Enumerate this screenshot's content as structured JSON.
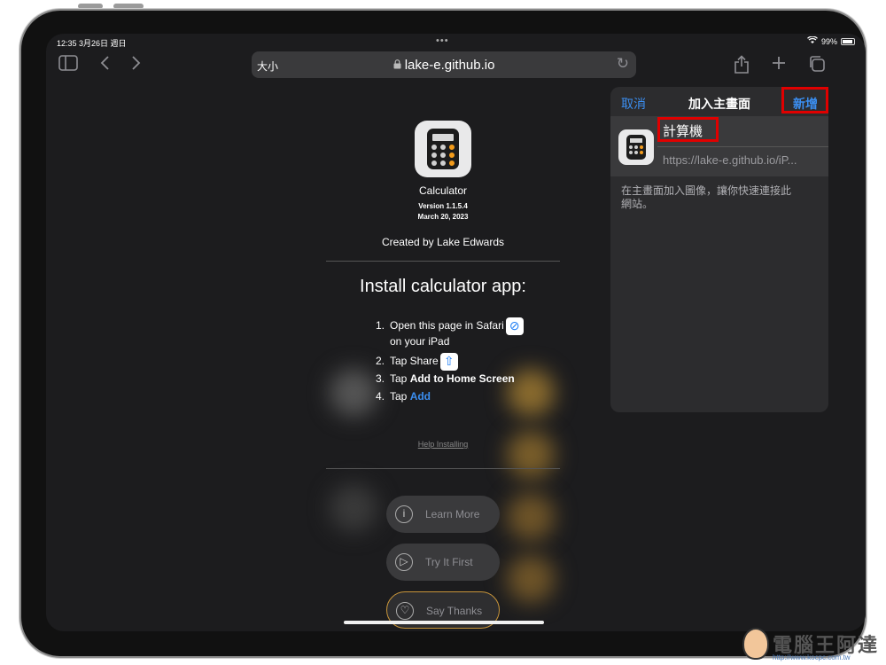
{
  "status": {
    "time_date": "12:35  3月26日 週日",
    "wifi_icon": "wifi-icon",
    "battery": "99%",
    "battery_level": 0.99
  },
  "toolbar": {
    "text_size_label": "大小",
    "url": "lake-e.github.io"
  },
  "page": {
    "app_name": "Calculator",
    "version": "Version 1.1.5.4",
    "date": "March 20, 2023",
    "created_by": "Created by Lake Edwards",
    "install_title": "Install calculator app:",
    "steps": [
      {
        "num": "1.",
        "text": "Open this page in Safari",
        "cont": "on your iPad"
      },
      {
        "num": "2.",
        "text": "Tap Share"
      },
      {
        "num": "3.",
        "text": "Tap ",
        "bold": "Add to Home Screen"
      },
      {
        "num": "4.",
        "text": "Tap ",
        "bold": "Add"
      }
    ],
    "help_link": "Help Installing",
    "buttons": {
      "learn_more": "Learn More",
      "try_it_first": "Try It First",
      "say_thanks": "Say Thanks"
    }
  },
  "popover": {
    "cancel": "取消",
    "title": "加入主畫面",
    "add": "新增",
    "name": "計算機",
    "url": "https://lake-e.github.io/iP...",
    "description": "在主畫面加入圖像，讓你快速連接此網站。"
  },
  "watermark": {
    "text": "電腦王阿達",
    "url": "http://www.kocpc.com.tw"
  },
  "colors": {
    "accent": "#3b8ef0",
    "highlight_box": "#e00000",
    "say_thanks_border": "#c8953a"
  }
}
